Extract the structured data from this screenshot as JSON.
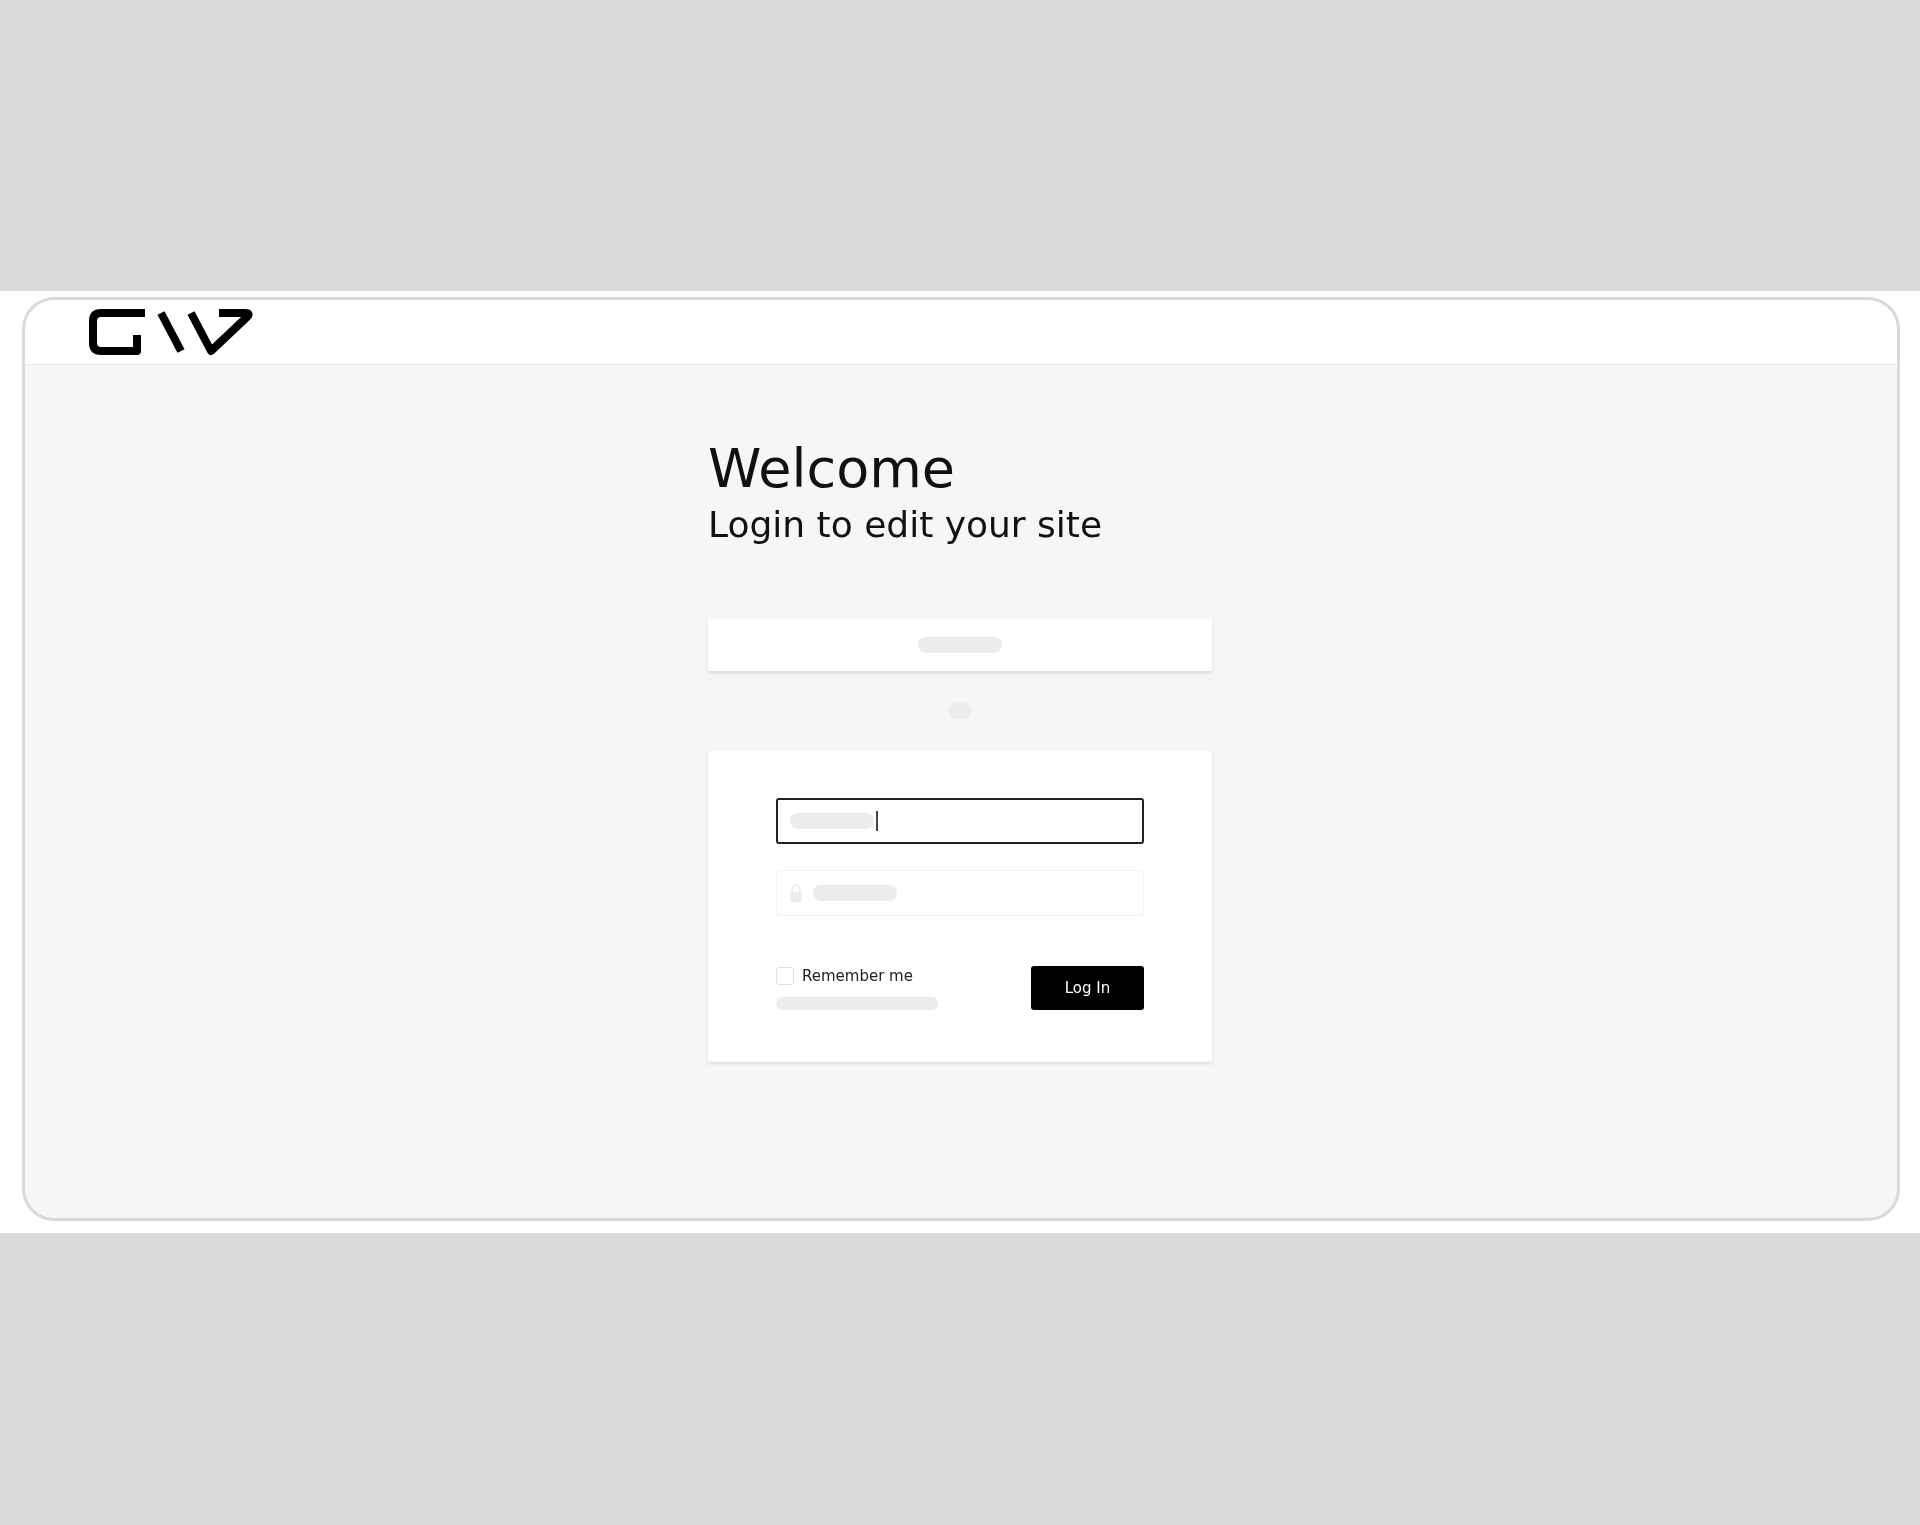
{
  "heading": {
    "title": "Welcome",
    "subtitle": "Login to edit your site"
  },
  "fields": [
    {
      "kind": "text",
      "focused": true
    },
    {
      "kind": "password",
      "focused": false
    }
  ],
  "remember_me": {
    "label": "Remember me",
    "checked": false
  },
  "login_button": {
    "label": "Log In"
  }
}
